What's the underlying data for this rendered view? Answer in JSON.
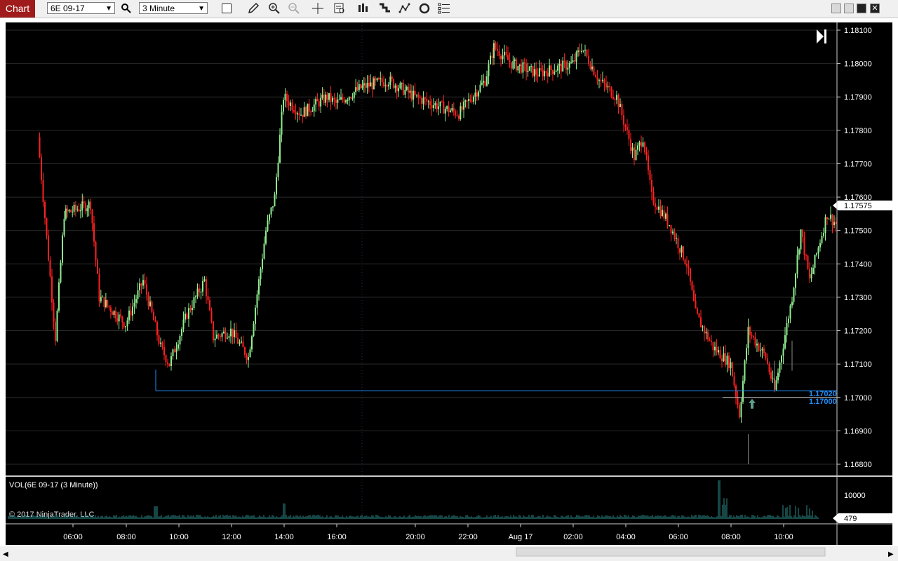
{
  "toolbar": {
    "chart_tab_label": "Chart",
    "instrument": "6E 09-17",
    "interval": "3 Minute",
    "icons": [
      "search-icon",
      "checkbox-icon",
      "pencil-icon",
      "zoom-in-icon",
      "zoom-out-icon",
      "crosshair-icon",
      "data-box-icon",
      "bar-spacing-icon",
      "order-icon",
      "strategy-icon",
      "reload-icon",
      "properties-icon"
    ]
  },
  "window_controls": [
    "minimize-icon",
    "restore-icon",
    "maximize-icon",
    "close-icon"
  ],
  "colors": {
    "up": "#90ee90",
    "down": "#ff2020",
    "line": "#1e90ff",
    "grid": "#2a2a2a",
    "volume": "#2e8b8b"
  },
  "price_panel": {
    "y_ticks": [
      "1.18100",
      "1.18000",
      "1.17900",
      "1.17800",
      "1.17700",
      "1.17600",
      "1.17500",
      "1.17400",
      "1.17300",
      "1.17200",
      "1.17100",
      "1.17000",
      "1.16900",
      "1.16800"
    ],
    "current_price": "1.17575",
    "line_labels": [
      "1.17020",
      "1.17000"
    ]
  },
  "volume_panel": {
    "title": "VOL(6E 09-17 (3 Minute))",
    "y_tick": "10000",
    "current_volume": "479",
    "copyright": "© 2017 NinjaTrader, LLC"
  },
  "x_axis": {
    "ticks": [
      "06:00",
      "08:00",
      "10:00",
      "12:00",
      "14:00",
      "16:00",
      "20:00",
      "22:00",
      "Aug 17",
      "02:00",
      "04:00",
      "06:00",
      "08:00",
      "10:00"
    ]
  },
  "chart_data": {
    "type": "candlestick",
    "instrument": "6E 09-17",
    "interval": "3 Minute",
    "ylim": [
      1.1678,
      1.1812
    ],
    "x_ticks": [
      "06:00",
      "08:00",
      "10:00",
      "12:00",
      "14:00",
      "16:00",
      "20:00",
      "22:00",
      "Aug 17",
      "02:00",
      "04:00",
      "06:00",
      "08:00",
      "10:00"
    ],
    "price_path": [
      {
        "t": "04:40",
        "p": 1.1778
      },
      {
        "t": "05:20",
        "p": 1.1718
      },
      {
        "t": "05:40",
        "p": 1.1755
      },
      {
        "t": "06:40",
        "p": 1.1758
      },
      {
        "t": "07:00",
        "p": 1.173
      },
      {
        "t": "08:00",
        "p": 1.1722
      },
      {
        "t": "08:40",
        "p": 1.1735
      },
      {
        "t": "09:20",
        "p": 1.1715
      },
      {
        "t": "09:40",
        "p": 1.171
      },
      {
        "t": "10:20",
        "p": 1.1725
      },
      {
        "t": "11:00",
        "p": 1.1735
      },
      {
        "t": "11:20",
        "p": 1.1718
      },
      {
        "t": "12:00",
        "p": 1.172
      },
      {
        "t": "12:40",
        "p": 1.1712
      },
      {
        "t": "13:20",
        "p": 1.175
      },
      {
        "t": "13:40",
        "p": 1.176
      },
      {
        "t": "14:00",
        "p": 1.179
      },
      {
        "t": "14:40",
        "p": 1.1785
      },
      {
        "t": "15:40",
        "p": 1.179
      },
      {
        "t": "16:00",
        "p": 1.1788
      },
      {
        "t": "17:00",
        "p": 1.1793
      },
      {
        "t": "18:00",
        "p": 1.1795
      },
      {
        "t": "19:00",
        "p": 1.179
      },
      {
        "t": "20:40",
        "p": 1.1785
      },
      {
        "t": "21:40",
        "p": 1.1795
      },
      {
        "t": "22:00",
        "p": 1.1805
      },
      {
        "t": "22:40",
        "p": 1.18
      },
      {
        "t": "23:40",
        "p": 1.1797
      },
      {
        "t": "01:00",
        "p": 1.18
      },
      {
        "t": "01:20",
        "p": 1.1805
      },
      {
        "t": "02:00",
        "p": 1.1795
      },
      {
        "t": "02:40",
        "p": 1.179
      },
      {
        "t": "03:20",
        "p": 1.1772
      },
      {
        "t": "03:40",
        "p": 1.1778
      },
      {
        "t": "04:00",
        "p": 1.176
      },
      {
        "t": "04:40",
        "p": 1.1752
      },
      {
        "t": "05:20",
        "p": 1.174
      },
      {
        "t": "05:40",
        "p": 1.1725
      },
      {
        "t": "06:20",
        "p": 1.1715
      },
      {
        "t": "07:00",
        "p": 1.171
      },
      {
        "t": "07:20",
        "p": 1.1695
      },
      {
        "t": "07:40",
        "p": 1.172
      },
      {
        "t": "08:20",
        "p": 1.1712
      },
      {
        "t": "08:40",
        "p": 1.1702
      },
      {
        "t": "09:20",
        "p": 1.173
      },
      {
        "t": "09:40",
        "p": 1.175
      },
      {
        "t": "10:00",
        "p": 1.1735
      },
      {
        "t": "10:40",
        "p": 1.1755
      },
      {
        "t": "11:00",
        "p": 1.1752
      }
    ],
    "lows": [
      {
        "t": "09:20",
        "p": 1.1708
      },
      {
        "t": "07:40",
        "p": 1.168
      },
      {
        "t": "08:40",
        "p": 1.1702
      }
    ],
    "highs": [
      {
        "t": "22:00",
        "p": 1.1808
      },
      {
        "t": "01:20",
        "p": 1.1808
      },
      {
        "t": "10:40",
        "p": 1.1765
      }
    ],
    "horizontal_lines": [
      1.1702,
      1.17
    ],
    "last_price": 1.17575,
    "volume_last": 479,
    "grid": true
  }
}
